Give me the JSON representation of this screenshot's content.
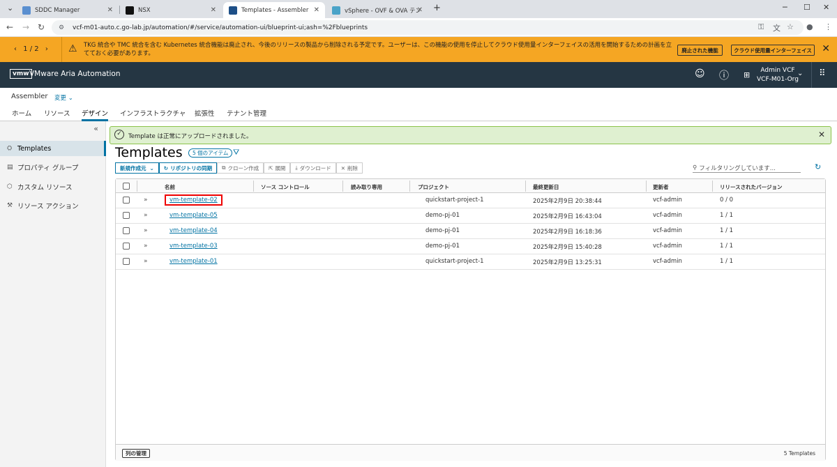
{
  "browser": {
    "tabs": [
      {
        "title": "SDDC Manager",
        "color": "#5a8fd0"
      },
      {
        "title": "NSX",
        "color": "#111111"
      },
      {
        "title": "Templates - Assembler",
        "color": "#1d4f87"
      },
      {
        "title": "vSphere - OVF & OVA テンプレー",
        "color": "#4aa3c8"
      }
    ],
    "new_tab": "+",
    "url": "vcf-m01-auto.c.go-lab.jp/automation/#/service/automation-ui/blueprint-ui;ash=%2Fblueprints"
  },
  "banner": {
    "pager": "1 / 2",
    "message": "TKG 統合や TMC 統合を含む Kubernetes 統合機能は廃止され、今後のリリースの製品から削除される予定です。ユーザーは、この機能の使用を停止してクラウド使用量インターフェイスの活用を開始するための計画を立てておく必要があります。",
    "button1": "廃止された機能",
    "button2": "クラウド使用量インターフェイス"
  },
  "appbar": {
    "logo": "vmw",
    "title": "VMware Aria Automation",
    "user_name": "Admin VCF",
    "org": "VCF-M01-Org"
  },
  "service": {
    "name": "Assembler",
    "change": "変更"
  },
  "main_tabs": [
    "ホーム",
    "リソース",
    "デザイン",
    "インフラストラクチャ",
    "拡張性",
    "テナント管理"
  ],
  "sidebar": {
    "items": [
      {
        "label": "Templates"
      },
      {
        "label": "プロパティ グループ"
      },
      {
        "label": "カスタム リソース"
      },
      {
        "label": "リソース アクション"
      }
    ]
  },
  "alert": {
    "text": "Template は正常にアップロードされました。"
  },
  "page": {
    "title": "Templates",
    "badge": "5 個のアイテム"
  },
  "toolbar": {
    "new": "新規作成元",
    "sync": "リポジトリの同期",
    "clone": "クローン作成",
    "deploy": "展開",
    "download": "ダウンロード",
    "delete": "削除"
  },
  "search": {
    "placeholder": "フィルタリングしています..."
  },
  "table": {
    "headers": [
      "名前",
      "ソース コントロール",
      "読み取り専用",
      "プロジェクト",
      "最終更新日",
      "更新者",
      "リリースされたバージョン"
    ],
    "rows": [
      {
        "name": "vm-template-02",
        "project": "quickstart-project-1",
        "updated": "2025年2月9日 20:38:44",
        "by": "vcf-admin",
        "version": "0 / 0"
      },
      {
        "name": "vm-template-05",
        "project": "demo-pj-01",
        "updated": "2025年2月9日 16:43:04",
        "by": "vcf-admin",
        "version": "1 / 1"
      },
      {
        "name": "vm-template-04",
        "project": "demo-pj-01",
        "updated": "2025年2月9日 16:18:36",
        "by": "vcf-admin",
        "version": "1 / 1"
      },
      {
        "name": "vm-template-03",
        "project": "demo-pj-01",
        "updated": "2025年2月9日 15:40:28",
        "by": "vcf-admin",
        "version": "1 / 1"
      },
      {
        "name": "vm-template-01",
        "project": "quickstart-project-1",
        "updated": "2025年2月9日 13:25:31",
        "by": "vcf-admin",
        "version": "1 / 1"
      }
    ],
    "column_manager": "列の管理",
    "footer_count": "5 Templates"
  }
}
